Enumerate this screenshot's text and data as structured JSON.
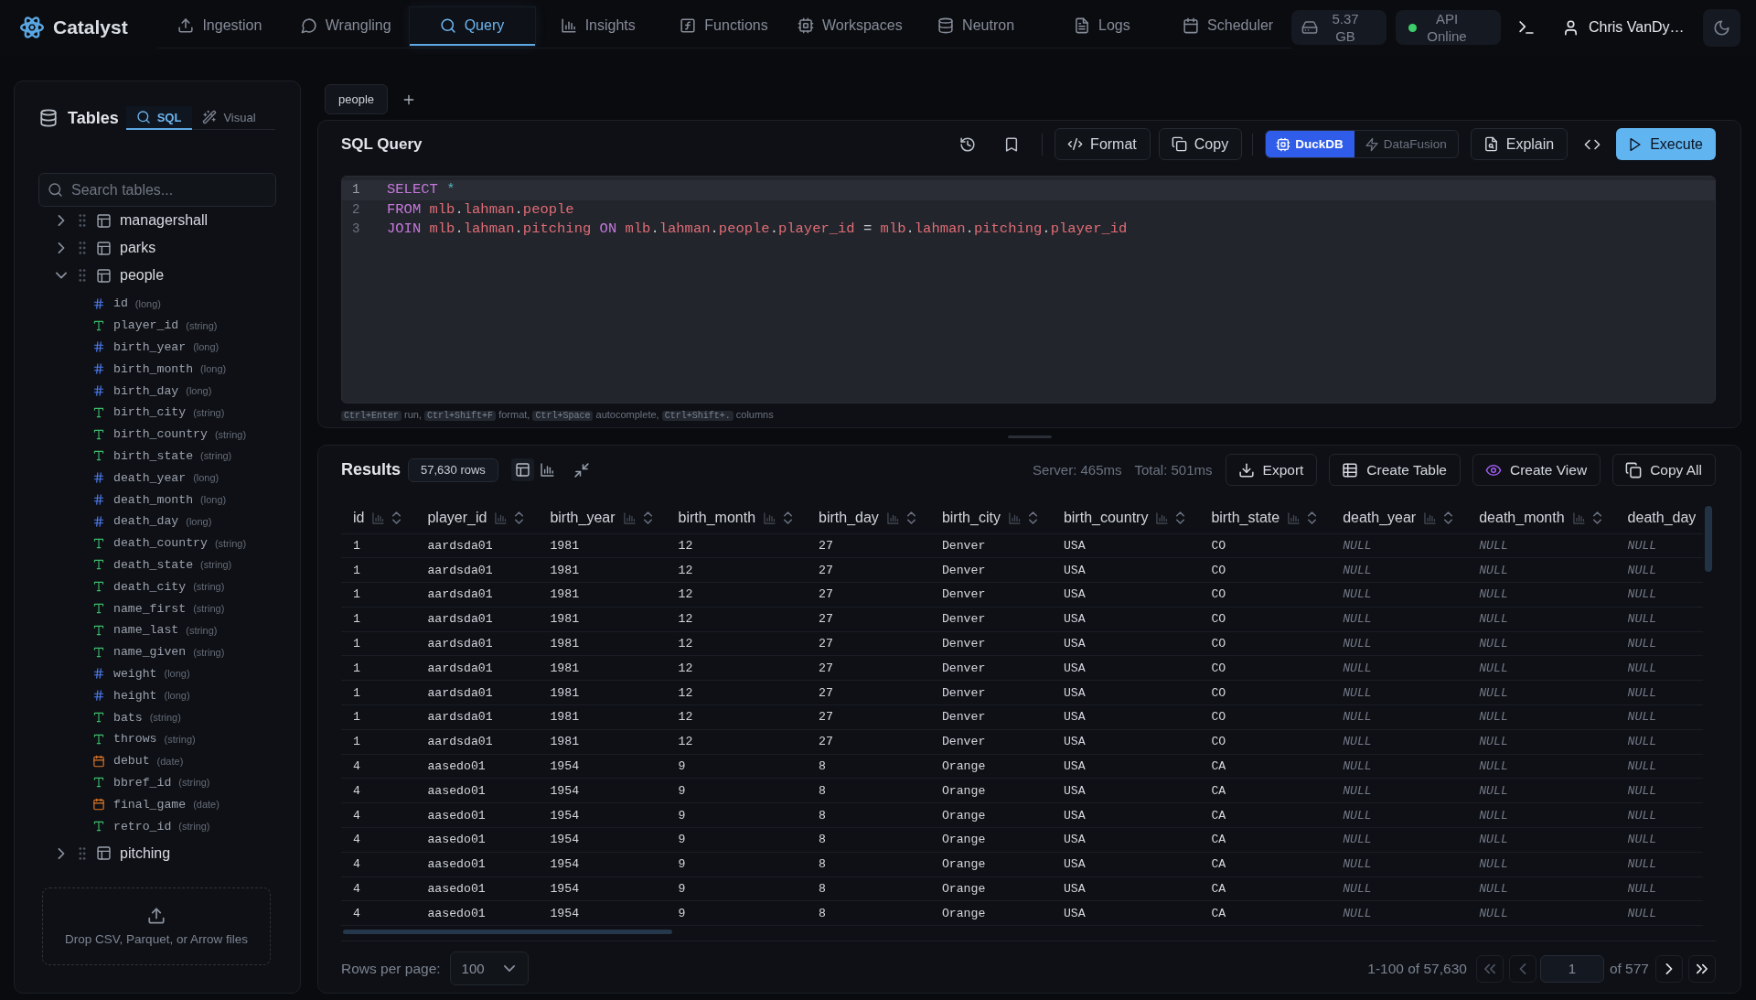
{
  "app": {
    "name": "Catalyst"
  },
  "nav": {
    "items": [
      {
        "label": "Ingestion",
        "selected": false
      },
      {
        "label": "Wrangling",
        "selected": false
      },
      {
        "label": "Query",
        "selected": true
      },
      {
        "label": "Insights",
        "selected": false
      },
      {
        "label": "Functions",
        "selected": false
      },
      {
        "label": "Workspaces",
        "selected": false
      },
      {
        "label": "Neutron",
        "selected": false
      },
      {
        "label": "Logs",
        "selected": false
      },
      {
        "label": "Scheduler",
        "selected": false
      }
    ]
  },
  "status": {
    "storage": "5.37 GB",
    "api": {
      "label": "API Online",
      "online": true
    }
  },
  "user": {
    "name": "Chris VanDy…"
  },
  "sidebar": {
    "title": "Tables",
    "modes": [
      {
        "label": "SQL",
        "selected": true
      },
      {
        "label": "Visual",
        "selected": false
      }
    ],
    "search": {
      "placeholder": "Search tables..."
    },
    "tables": [
      {
        "name": "managershall",
        "expanded": false
      },
      {
        "name": "parks",
        "expanded": false
      },
      {
        "name": "people",
        "expanded": true,
        "children": [
          {
            "name": "id",
            "type": "(long)",
            "kind": "number"
          },
          {
            "name": "player_id",
            "type": "(string)",
            "kind": "text"
          },
          {
            "name": "birth_year",
            "type": "(long)",
            "kind": "number"
          },
          {
            "name": "birth_month",
            "type": "(long)",
            "kind": "number"
          },
          {
            "name": "birth_day",
            "type": "(long)",
            "kind": "number"
          },
          {
            "name": "birth_city",
            "type": "(string)",
            "kind": "text"
          },
          {
            "name": "birth_country",
            "type": "(string)",
            "kind": "text"
          },
          {
            "name": "birth_state",
            "type": "(string)",
            "kind": "text"
          },
          {
            "name": "death_year",
            "type": "(long)",
            "kind": "number"
          },
          {
            "name": "death_month",
            "type": "(long)",
            "kind": "number"
          },
          {
            "name": "death_day",
            "type": "(long)",
            "kind": "number"
          },
          {
            "name": "death_country",
            "type": "(string)",
            "kind": "text"
          },
          {
            "name": "death_state",
            "type": "(string)",
            "kind": "text"
          },
          {
            "name": "death_city",
            "type": "(string)",
            "kind": "text"
          },
          {
            "name": "name_first",
            "type": "(string)",
            "kind": "text"
          },
          {
            "name": "name_last",
            "type": "(string)",
            "kind": "text"
          },
          {
            "name": "name_given",
            "type": "(string)",
            "kind": "text"
          },
          {
            "name": "weight",
            "type": "(long)",
            "kind": "number"
          },
          {
            "name": "height",
            "type": "(long)",
            "kind": "number"
          },
          {
            "name": "bats",
            "type": "(string)",
            "kind": "text"
          },
          {
            "name": "throws",
            "type": "(string)",
            "kind": "text"
          },
          {
            "name": "debut",
            "type": "(date)",
            "kind": "date"
          },
          {
            "name": "bbref_id",
            "type": "(string)",
            "kind": "text"
          },
          {
            "name": "final_game",
            "type": "(date)",
            "kind": "date"
          },
          {
            "name": "retro_id",
            "type": "(string)",
            "kind": "text"
          }
        ]
      },
      {
        "name": "pitching",
        "expanded": false
      }
    ],
    "dropzone": "Drop CSV, Parquet, or Arrow files"
  },
  "query_tabs": [
    {
      "label": "people",
      "selected": true
    }
  ],
  "editor": {
    "title": "SQL Query",
    "tools": [
      {
        "label": "Format"
      },
      {
        "label": "Copy"
      }
    ],
    "engines": [
      {
        "label": "DuckDB",
        "selected": true
      },
      {
        "label": "DataFusion",
        "selected": false
      }
    ],
    "explain": "Explain",
    "execute": "Execute",
    "lines": [
      {
        "number": "1",
        "active": true,
        "tokens": [
          {
            "text": "SELECT ",
            "kind": "keyword"
          },
          {
            "text": "*",
            "kind": "operator"
          }
        ]
      },
      {
        "number": "2",
        "active": false,
        "tokens": [
          {
            "text": "FROM ",
            "kind": "keyword"
          },
          {
            "text": "mlb",
            "kind": "identifier"
          },
          {
            "text": ".",
            "kind": "punctuation"
          },
          {
            "text": "lahman",
            "kind": "identifier"
          },
          {
            "text": ".",
            "kind": "punctuation"
          },
          {
            "text": "people",
            "kind": "identifier"
          }
        ]
      },
      {
        "number": "3",
        "active": false,
        "tokens": [
          {
            "text": "JOIN ",
            "kind": "keyword"
          },
          {
            "text": "mlb",
            "kind": "identifier"
          },
          {
            "text": ".",
            "kind": "punctuation"
          },
          {
            "text": "lahman",
            "kind": "identifier"
          },
          {
            "text": ".",
            "kind": "punctuation"
          },
          {
            "text": "pitching ",
            "kind": "identifier"
          },
          {
            "text": "ON ",
            "kind": "keyword"
          },
          {
            "text": "mlb",
            "kind": "identifier"
          },
          {
            "text": ".",
            "kind": "punctuation"
          },
          {
            "text": "lahman",
            "kind": "identifier"
          },
          {
            "text": ".",
            "kind": "punctuation"
          },
          {
            "text": "people",
            "kind": "identifier"
          },
          {
            "text": ".",
            "kind": "punctuation"
          },
          {
            "text": "player_id ",
            "kind": "identifier"
          },
          {
            "text": "= ",
            "kind": "punctuation"
          },
          {
            "text": "mlb",
            "kind": "identifier"
          },
          {
            "text": ".",
            "kind": "punctuation"
          },
          {
            "text": "lahman",
            "kind": "identifier"
          },
          {
            "text": ".",
            "kind": "punctuation"
          },
          {
            "text": "pitching",
            "kind": "identifier"
          },
          {
            "text": ".",
            "kind": "punctuation"
          },
          {
            "text": "player_id",
            "kind": "identifier"
          }
        ]
      }
    ],
    "hints": [
      {
        "key": "Ctrl+Enter",
        "text": "run,"
      },
      {
        "key": "Ctrl+Shift+F",
        "text": "format,"
      },
      {
        "key": "Ctrl+Space",
        "text": "autocomplete,"
      },
      {
        "key": "Ctrl+Shift+.",
        "text": "columns"
      }
    ]
  },
  "results": {
    "title": "Results",
    "row_count": "57,630 rows",
    "views": [
      {
        "selected": true
      },
      {
        "selected": false
      }
    ],
    "timing": {
      "server": "Server: 465ms",
      "total": "Total: 501ms"
    },
    "actions": [
      {
        "label": "Export"
      },
      {
        "label": "Create Table"
      },
      {
        "label": "Create View"
      },
      {
        "label": "Copy All"
      }
    ],
    "columns": [
      {
        "name": "id",
        "sortable": true
      },
      {
        "name": "player_id",
        "sortable": true
      },
      {
        "name": "birth_year",
        "sortable": true
      },
      {
        "name": "birth_month",
        "sortable": true
      },
      {
        "name": "birth_day",
        "sortable": true
      },
      {
        "name": "birth_city",
        "sortable": true
      },
      {
        "name": "birth_country",
        "sortable": true
      },
      {
        "name": "birth_state",
        "sortable": true
      },
      {
        "name": "death_year",
        "sortable": true
      },
      {
        "name": "death_month",
        "sortable": true
      },
      {
        "name": "death_day",
        "sortable": false
      }
    ],
    "rows": [
      [
        "1",
        "aardsda01",
        "1981",
        "12",
        "27",
        "Denver",
        "USA",
        "CO",
        {
          "text": "NULL",
          "kind": "null"
        },
        {
          "text": "NULL",
          "kind": "null"
        },
        {
          "text": "NULL",
          "kind": "null"
        }
      ],
      [
        "1",
        "aardsda01",
        "1981",
        "12",
        "27",
        "Denver",
        "USA",
        "CO",
        {
          "text": "NULL",
          "kind": "null"
        },
        {
          "text": "NULL",
          "kind": "null"
        },
        {
          "text": "NULL",
          "kind": "null"
        }
      ],
      [
        "1",
        "aardsda01",
        "1981",
        "12",
        "27",
        "Denver",
        "USA",
        "CO",
        {
          "text": "NULL",
          "kind": "null"
        },
        {
          "text": "NULL",
          "kind": "null"
        },
        {
          "text": "NULL",
          "kind": "null"
        }
      ],
      [
        "1",
        "aardsda01",
        "1981",
        "12",
        "27",
        "Denver",
        "USA",
        "CO",
        {
          "text": "NULL",
          "kind": "null"
        },
        {
          "text": "NULL",
          "kind": "null"
        },
        {
          "text": "NULL",
          "kind": "null"
        }
      ],
      [
        "1",
        "aardsda01",
        "1981",
        "12",
        "27",
        "Denver",
        "USA",
        "CO",
        {
          "text": "NULL",
          "kind": "null"
        },
        {
          "text": "NULL",
          "kind": "null"
        },
        {
          "text": "NULL",
          "kind": "null"
        }
      ],
      [
        "1",
        "aardsda01",
        "1981",
        "12",
        "27",
        "Denver",
        "USA",
        "CO",
        {
          "text": "NULL",
          "kind": "null"
        },
        {
          "text": "NULL",
          "kind": "null"
        },
        {
          "text": "NULL",
          "kind": "null"
        }
      ],
      [
        "1",
        "aardsda01",
        "1981",
        "12",
        "27",
        "Denver",
        "USA",
        "CO",
        {
          "text": "NULL",
          "kind": "null"
        },
        {
          "text": "NULL",
          "kind": "null"
        },
        {
          "text": "NULL",
          "kind": "null"
        }
      ],
      [
        "1",
        "aardsda01",
        "1981",
        "12",
        "27",
        "Denver",
        "USA",
        "CO",
        {
          "text": "NULL",
          "kind": "null"
        },
        {
          "text": "NULL",
          "kind": "null"
        },
        {
          "text": "NULL",
          "kind": "null"
        }
      ],
      [
        "1",
        "aardsda01",
        "1981",
        "12",
        "27",
        "Denver",
        "USA",
        "CO",
        {
          "text": "NULL",
          "kind": "null"
        },
        {
          "text": "NULL",
          "kind": "null"
        },
        {
          "text": "NULL",
          "kind": "null"
        }
      ],
      [
        "4",
        "aasedo01",
        "1954",
        "9",
        "8",
        "Orange",
        "USA",
        "CA",
        {
          "text": "NULL",
          "kind": "null"
        },
        {
          "text": "NULL",
          "kind": "null"
        },
        {
          "text": "NULL",
          "kind": "null"
        }
      ],
      [
        "4",
        "aasedo01",
        "1954",
        "9",
        "8",
        "Orange",
        "USA",
        "CA",
        {
          "text": "NULL",
          "kind": "null"
        },
        {
          "text": "NULL",
          "kind": "null"
        },
        {
          "text": "NULL",
          "kind": "null"
        }
      ],
      [
        "4",
        "aasedo01",
        "1954",
        "9",
        "8",
        "Orange",
        "USA",
        "CA",
        {
          "text": "NULL",
          "kind": "null"
        },
        {
          "text": "NULL",
          "kind": "null"
        },
        {
          "text": "NULL",
          "kind": "null"
        }
      ],
      [
        "4",
        "aasedo01",
        "1954",
        "9",
        "8",
        "Orange",
        "USA",
        "CA",
        {
          "text": "NULL",
          "kind": "null"
        },
        {
          "text": "NULL",
          "kind": "null"
        },
        {
          "text": "NULL",
          "kind": "null"
        }
      ],
      [
        "4",
        "aasedo01",
        "1954",
        "9",
        "8",
        "Orange",
        "USA",
        "CA",
        {
          "text": "NULL",
          "kind": "null"
        },
        {
          "text": "NULL",
          "kind": "null"
        },
        {
          "text": "NULL",
          "kind": "null"
        }
      ],
      [
        "4",
        "aasedo01",
        "1954",
        "9",
        "8",
        "Orange",
        "USA",
        "CA",
        {
          "text": "NULL",
          "kind": "null"
        },
        {
          "text": "NULL",
          "kind": "null"
        },
        {
          "text": "NULL",
          "kind": "null"
        }
      ],
      [
        "4",
        "aasedo01",
        "1954",
        "9",
        "8",
        "Orange",
        "USA",
        "CA",
        {
          "text": "NULL",
          "kind": "null"
        },
        {
          "text": "NULL",
          "kind": "null"
        },
        {
          "text": "NULL",
          "kind": "null"
        }
      ]
    ],
    "footer": {
      "rows_per_page_label": "Rows per page:",
      "rows_per_page": "100",
      "range": "1-100 of 57,630",
      "page": "1",
      "page_total": "of 577",
      "back": [
        {
          "disabled": true
        },
        {
          "disabled": true
        }
      ],
      "forward": [
        {
          "disabled": false
        },
        {
          "disabled": false
        }
      ]
    }
  }
}
